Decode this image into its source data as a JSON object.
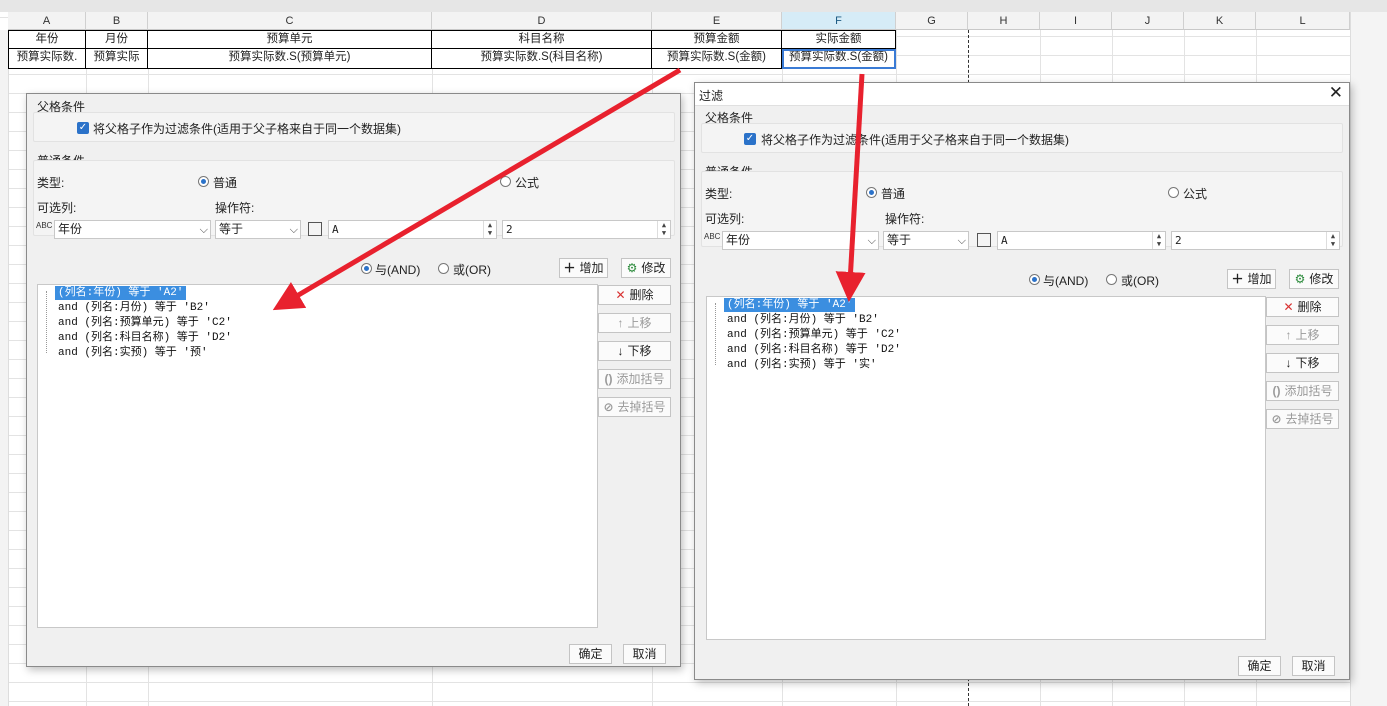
{
  "sheet": {
    "columns": [
      "A",
      "B",
      "C",
      "D",
      "E",
      "F",
      "G",
      "H",
      "I",
      "J",
      "K",
      "L"
    ],
    "selected_column": "F",
    "header_row": [
      "年份",
      "月份",
      "预算单元",
      "科目名称",
      "预算金额",
      "实际金额"
    ],
    "data_row": [
      "预算实际数.",
      "预算实际",
      "预算实际数.S(预算单元)",
      "预算实际数.S(科目名称)",
      "预算实际数.S(金额)",
      "预算实际数.S(金额)"
    ]
  },
  "dialog_left": {
    "parent_section": "父格条件",
    "parent_checkbox": "将父格子作为过滤条件(适用于父子格来自于同一个数据集)",
    "normal_section": "普通条件",
    "type_label": "类型:",
    "type_normal": "普通",
    "type_formula": "公式",
    "column_label": "可选列:",
    "operator_label": "操作符:",
    "column_value": "年份",
    "operator_value": "等于",
    "value_a": "A",
    "value_b": "2",
    "and_label": "与(AND)",
    "or_label": "或(OR)",
    "add_button": "增加",
    "modify_button": "修改",
    "conditions": [
      "(列名:年份) 等于 'A2'",
      "and (列名:月份) 等于 'B2'",
      "and (列名:预算单元) 等于 'C2'",
      "and (列名:科目名称) 等于 'D2'",
      "and (列名:实预) 等于 '预'"
    ],
    "delete_button": "删除",
    "up_button": "上移",
    "down_button": "下移",
    "add_paren_button": "添加括号",
    "remove_paren_button": "去掉括号",
    "ok_button": "确定",
    "cancel_button": "取消"
  },
  "dialog_right": {
    "title": "过滤",
    "parent_section": "父格条件",
    "parent_checkbox": "将父格子作为过滤条件(适用于父子格来自于同一个数据集)",
    "normal_section": "普通条件",
    "type_label": "类型:",
    "type_normal": "普通",
    "type_formula": "公式",
    "column_label": "可选列:",
    "operator_label": "操作符:",
    "column_value": "年份",
    "operator_value": "等于",
    "value_a": "A",
    "value_b": "2",
    "and_label": "与(AND)",
    "or_label": "或(OR)",
    "add_button": "增加",
    "modify_button": "修改",
    "conditions": [
      "(列名:年份) 等于 'A2'",
      "and (列名:月份) 等于 'B2'",
      "and (列名:预算单元) 等于 'C2'",
      "and (列名:科目名称) 等于 'D2'",
      "and (列名:实预) 等于 '实'"
    ],
    "delete_button": "删除",
    "up_button": "上移",
    "down_button": "下移",
    "add_paren_button": "添加括号",
    "remove_paren_button": "去掉括号",
    "ok_button": "确定",
    "cancel_button": "取消"
  },
  "colors": {
    "arrow": "#e8212e",
    "accent": "#2b72c9",
    "selection": "#3b8ee0"
  }
}
